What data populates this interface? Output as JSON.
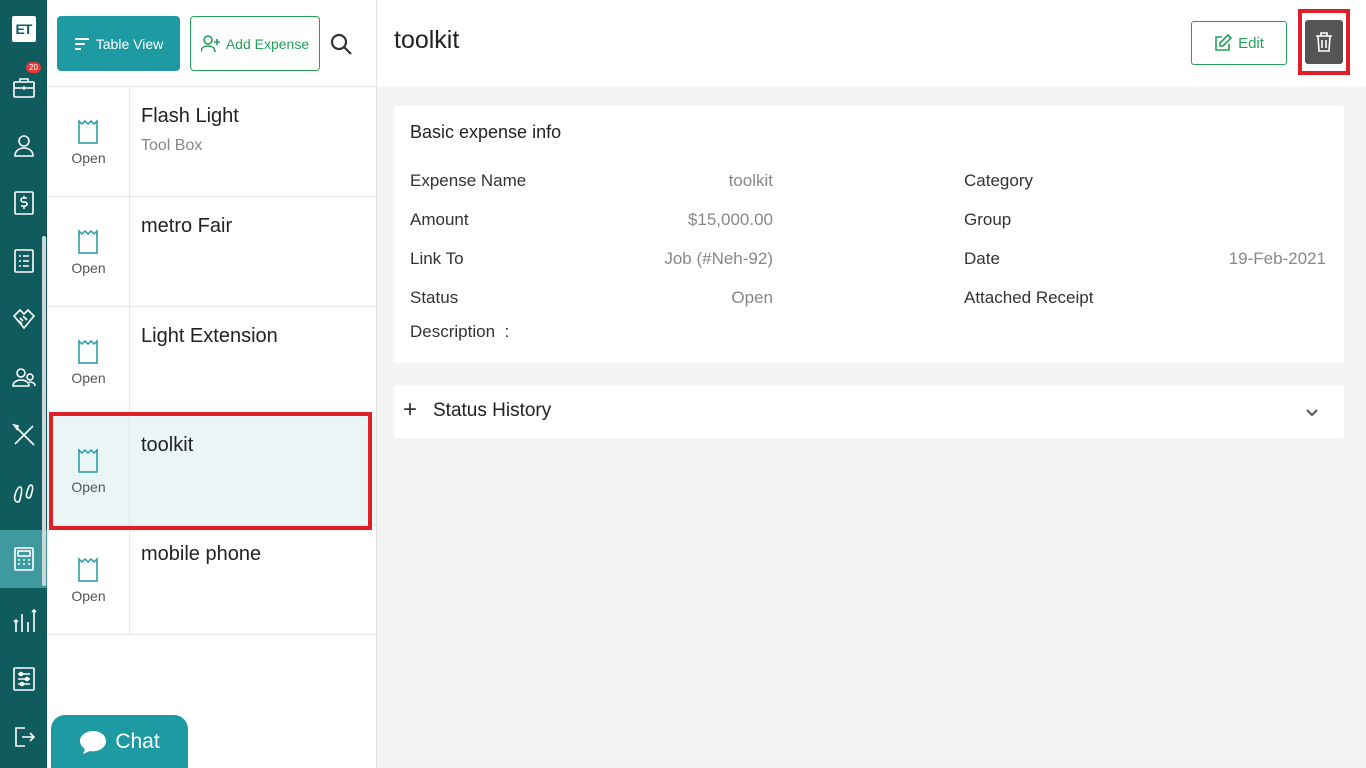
{
  "sidebar": {
    "logo": "ET",
    "badge_count": "20",
    "items": [
      {
        "icon": "briefcase-icon"
      },
      {
        "icon": "user-icon"
      },
      {
        "icon": "dollar-icon"
      },
      {
        "icon": "list-icon"
      },
      {
        "icon": "handshake-icon"
      },
      {
        "icon": "users-icon"
      },
      {
        "icon": "tools-icon"
      },
      {
        "icon": "footprints-icon"
      },
      {
        "icon": "calculator-icon",
        "active": true
      },
      {
        "icon": "reports-icon"
      },
      {
        "icon": "settings-sliders-icon"
      },
      {
        "icon": "logout-icon"
      }
    ]
  },
  "toolbar": {
    "table_view_label": "Table View",
    "add_expense_label": "Add Expense"
  },
  "expenses": [
    {
      "title": "Flash Light",
      "subtitle": "Tool Box",
      "status": "Open"
    },
    {
      "title": "metro Fair",
      "subtitle": "",
      "status": "Open"
    },
    {
      "title": "Light Extension",
      "subtitle": "",
      "status": "Open"
    },
    {
      "title": "toolkit",
      "subtitle": "",
      "status": "Open",
      "selected": true
    },
    {
      "title": "mobile phone",
      "subtitle": "",
      "status": "Open"
    }
  ],
  "chat": {
    "label": "Chat"
  },
  "detail": {
    "title": "toolkit",
    "edit_label": "Edit",
    "basic_info": {
      "heading": "Basic expense info",
      "expense_name_label": "Expense Name",
      "expense_name": "toolkit",
      "amount_label": "Amount",
      "amount": "$15,000.00",
      "link_to_label": "Link To",
      "link_to": "Job (#Neh-92)",
      "status_label": "Status",
      "status": "Open",
      "description_label": "Description  :",
      "category_label": "Category",
      "category": "",
      "group_label": "Group",
      "group": "",
      "date_label": "Date",
      "date": "19-Feb-2021",
      "receipt_label": "Attached Receipt"
    },
    "status_history_label": "Status History"
  },
  "colors": {
    "sidebar": "#0f5b5e",
    "accent": "#1e9aa2",
    "green": "#23a05a",
    "highlight": "#e01f26"
  }
}
